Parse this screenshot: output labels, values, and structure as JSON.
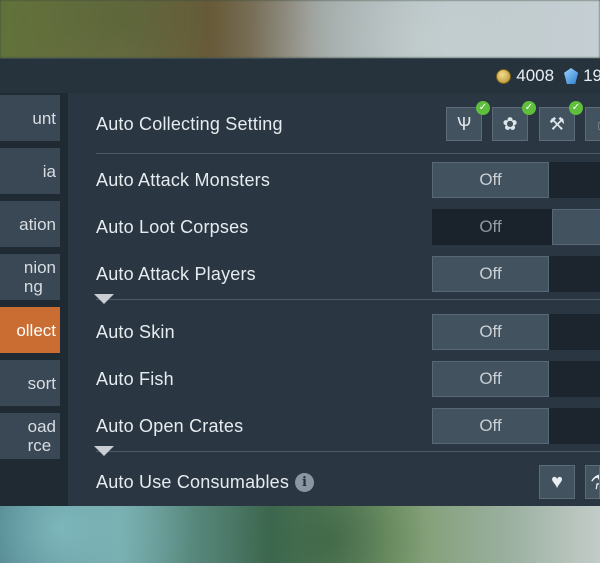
{
  "currency": {
    "coins": "4008",
    "crystals": "19"
  },
  "sidebar": {
    "items": [
      {
        "label": "unt",
        "icon": ""
      },
      {
        "label": "ia",
        "icon": ""
      },
      {
        "label": "ation",
        "icon": ""
      },
      {
        "label": "nion\nng",
        "icon": ""
      },
      {
        "label": "ollect",
        "icon": ""
      },
      {
        "label": "sort",
        "icon": ""
      },
      {
        "label": "oad\nrce",
        "icon": ""
      }
    ],
    "active_index": 4
  },
  "settings": {
    "collecting": {
      "label": "Auto Collecting Setting",
      "slots": [
        {
          "icon": "grass-icon",
          "glyph": "Ѱ",
          "checked": true
        },
        {
          "icon": "berries-icon",
          "glyph": "✿",
          "checked": true
        },
        {
          "icon": "tool-icon",
          "glyph": "⚒",
          "checked": true
        },
        {
          "icon": "hand-icon",
          "glyph": "☝",
          "checked": false
        }
      ]
    },
    "toggles": [
      {
        "label": "Auto Attack Monsters",
        "state": "Off"
      },
      {
        "label": "Auto Loot Corpses",
        "state": "Off"
      },
      {
        "label": "Auto Attack Players",
        "state": "Off"
      },
      {
        "label": "Auto Skin",
        "state": "Off"
      },
      {
        "label": "Auto Fish",
        "state": "Off"
      },
      {
        "label": "Auto Open Crates",
        "state": "Off"
      }
    ],
    "consumables": {
      "label": "Auto Use Consumables",
      "info_glyph": "i",
      "heart_glyph": "♥",
      "extra_glyph": "⚗"
    }
  },
  "colors": {
    "accent_active_tab": "#c96d33",
    "check_green": "#5fbf3d",
    "panel_bg": "#2a3742"
  }
}
